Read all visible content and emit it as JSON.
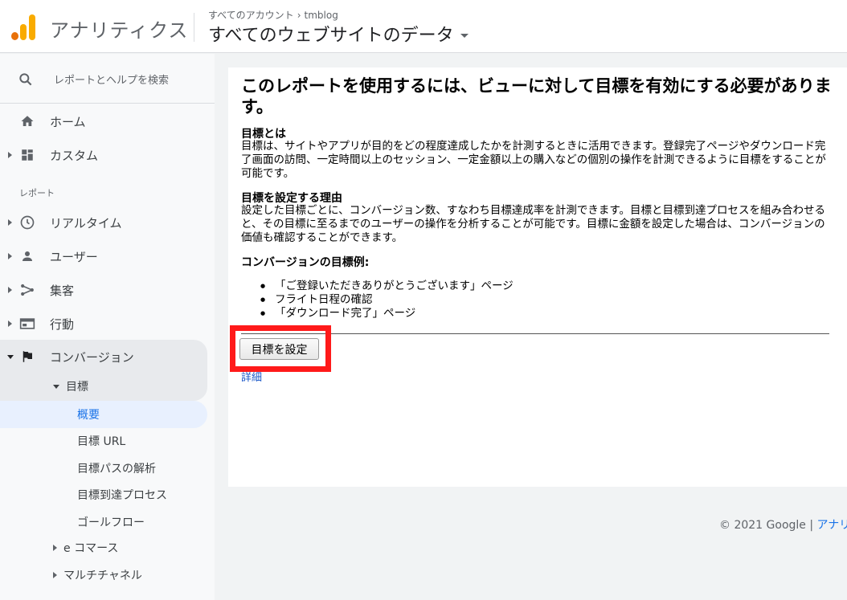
{
  "header": {
    "app_title": "アナリティクス",
    "breadcrumb_account": "すべてのアカウント",
    "breadcrumb_property": "tmblog",
    "view_title": "すべてのウェブサイトのデータ"
  },
  "sidebar": {
    "search_placeholder": "レポートとヘルプを検索",
    "home": "ホーム",
    "custom": "カスタム",
    "reports_section": "レポート",
    "realtime": "リアルタイム",
    "users": "ユーザー",
    "acquisition": "集客",
    "behavior": "行動",
    "conversions": "コンバージョン",
    "goals": "目標",
    "goals_items": [
      "概要",
      "目標 URL",
      "目標パスの解析",
      "目標到達プロセス",
      "ゴールフロー"
    ],
    "ecommerce": "e コマース",
    "multichannel": "マルチチャネル"
  },
  "main": {
    "heading": "このレポートを使用するには、ビューに対して目標を有効にする必要があります。",
    "what_title": "目標とは",
    "what_body": "目標は、サイトやアプリが目的をどの程度達成したかを計測するときに活用できます。登録完了ページやダウンロード完了画面の訪問、一定時間以上のセッション、一定金額以上の購入などの個別の操作を計測できるように目標をすることが可能です。",
    "why_title": "目標を設定する理由",
    "why_body": "設定した目標ごとに、コンバージョン数、すなわち目標達成率を計測できます。目標と目標到達プロセスを組み合わせると、その目標に至るまでのユーザーの操作を分析することが可能です。目標に金額を設定した場合は、コンバージョンの価値も確認することができます。",
    "examples_title": "コンバージョンの目標例:",
    "examples": [
      "「ご登録いただきありがとうございます」ページ",
      "フライト日程の確認",
      "「ダウンロード完了」ページ"
    ],
    "set_goal_button": "目標を設定",
    "detail_link": "詳細"
  },
  "footer": {
    "copyright": "© 2021 Google |",
    "link": "アナリ"
  },
  "colors": {
    "highlight_box": "#ff1a1a",
    "selected_text": "#1a73e8",
    "logo_orange": "#f9ab00"
  }
}
